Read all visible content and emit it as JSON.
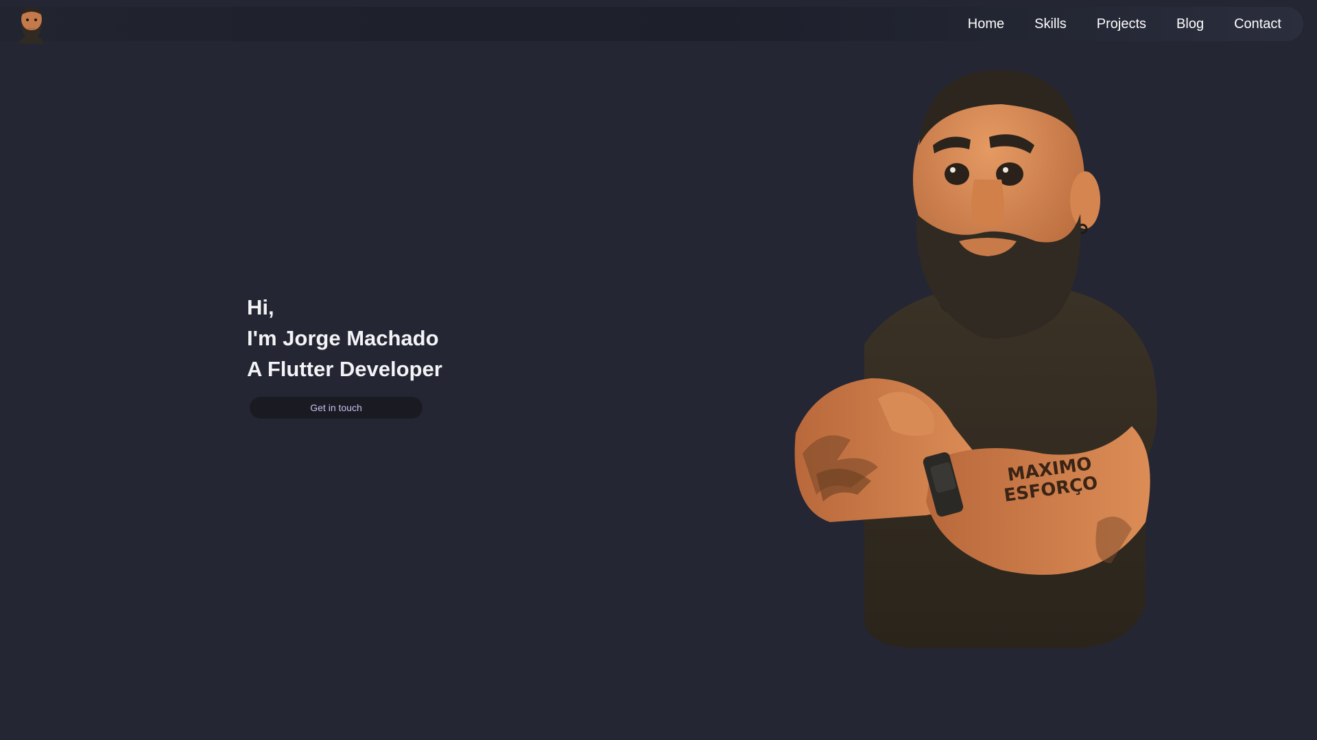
{
  "header": {
    "logo_icon": "avatar-head-icon",
    "nav": [
      {
        "label": "Home"
      },
      {
        "label": "Skills"
      },
      {
        "label": "Projects"
      },
      {
        "label": "Blog"
      },
      {
        "label": "Contact"
      }
    ]
  },
  "hero": {
    "greeting": "Hi,",
    "name_line": "I'm Jorge Machado",
    "role_line": "A Flutter Developer",
    "cta_label": "Get in touch"
  },
  "illustration": {
    "tattoo_text_1": "MAXIMO",
    "tattoo_text_2": "ESFORÇO",
    "subject_icon": "bearded-man-avatar"
  },
  "colors": {
    "background": "#242634",
    "button_bg": "#1a1b22",
    "button_text": "#c9bff2"
  }
}
